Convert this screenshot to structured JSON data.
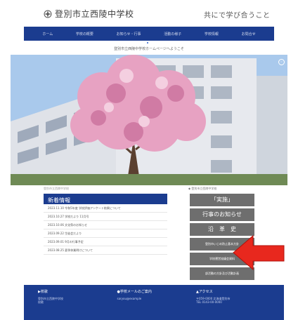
{
  "header": {
    "school_name": "登別市立西陵中学校",
    "tagline": "共にで学び合うこと",
    "subtitle": "登別市立西陵中学校ホームページへようこそ"
  },
  "nav": [
    {
      "label": "ホーム"
    },
    {
      "label": "学校の概要"
    },
    {
      "label": "お知らせ・行事"
    },
    {
      "label": "活動の様子"
    },
    {
      "label": "学校情報"
    },
    {
      "label": "お問合せ"
    }
  ],
  "hero": {
    "control_label": "◦"
  },
  "captions": {
    "left": "登別市立西陵中学校",
    "right": "◆ 登別市立西陵中学校"
  },
  "news": {
    "title": "新着情報",
    "items": [
      "2023.11.10 令和5年度 学校評価アンケート結果について",
      "2023.10.27 学校だより 11月号",
      "2023.10.06 文化祭のお知らせ",
      "2023.09.22 生徒会だより",
      "2023.09.01 9月の行事予定",
      "2023.08.25 夏季休業明けについて"
    ]
  },
  "side_buttons": [
    {
      "label": "「実施」",
      "size": "big"
    },
    {
      "label": "行事のお知らせ",
      "size": "big"
    },
    {
      "label": "沿　革　史",
      "size": "big"
    },
    {
      "label": "登別市いじめ防止基本方針",
      "size": "small"
    },
    {
      "label": "学校運営協議会資料",
      "size": "small"
    },
    {
      "label": "部活動の方針及び活動計画",
      "size": "small"
    }
  ],
  "footer": {
    "col1": {
      "head": "▶校歌",
      "lines": [
        "登別市立西陵中学校",
        "校歌"
      ]
    },
    "col2": {
      "head": "●学校メールのご案内",
      "lines": [
        "saryou@example"
      ]
    },
    "col3": {
      "head": "▲アクセス",
      "lines": [
        "〒059-0000 北海道登別市",
        "TEL 0143-00-0000"
      ]
    }
  },
  "colors": {
    "brand": "#1b3c8f",
    "button": "#6e6e6e",
    "arrow": "#e8281e"
  }
}
